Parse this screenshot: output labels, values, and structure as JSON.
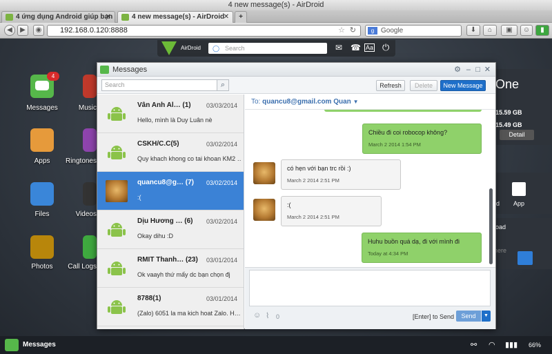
{
  "browser": {
    "window_title": "4 new message(s) - AirDroid",
    "tabs": [
      {
        "label": "4 ứng dụng Android giúp bạn d…"
      },
      {
        "label": "4 new message(s) - AirDroid"
      }
    ],
    "url": "192.168.0.120:8888",
    "search_placeholder": "Google"
  },
  "airdroid": {
    "logo": "AirDroid",
    "search_placeholder": "Search"
  },
  "desktop": {
    "apps": [
      {
        "label": "Messages",
        "badge": "4"
      },
      {
        "label": "Music"
      },
      {
        "label": "Apps"
      },
      {
        "label": "Ringtones"
      },
      {
        "label": "Files"
      },
      {
        "label": "Videos"
      },
      {
        "label": "Photos"
      },
      {
        "label": "Call Logs"
      }
    ],
    "right_panel": {
      "title": "One",
      "storage1": "15.59 GB",
      "storage2": "15.49 GB",
      "detail": "Detail",
      "card": "rd",
      "app": "App",
      "upload": "load",
      "here": "here"
    }
  },
  "messages_window": {
    "title": "Messages",
    "search_placeholder": "Search",
    "toolbar": {
      "refresh": "Refresh",
      "delete": "Delete",
      "new": "New Message"
    },
    "threads": [
      {
        "name": "Vân Anh Al…",
        "count": "(1)",
        "date": "03/03/2014",
        "preview": "Hello, mình là Duy Luân nè"
      },
      {
        "name": "CSKH/C.C(5)",
        "count": "",
        "date": "03/02/2014",
        "preview": "Quy khach khong co tai khoan KM2 …"
      },
      {
        "name": "quancu8@g…",
        "count": "(7)",
        "date": "03/02/2014",
        "preview": ":(",
        "selected": true
      },
      {
        "name": "Dịu Hương …",
        "count": "(6)",
        "date": "03/02/2014",
        "preview": "Okay dihu :D"
      },
      {
        "name": "RMIT Thanh…",
        "count": "(23)",
        "date": "03/01/2014",
        "preview": "Ok vaayh thứ mấy dc bạn chọn đj"
      },
      {
        "name": "8788(1)",
        "count": "",
        "date": "03/01/2014",
        "preview": "(Zalo) 6051 la ma kich hoat Zalo. H…"
      }
    ],
    "conversation": {
      "to_label": "To:",
      "to_value": "quancu8@gmail.com Quan",
      "messages": [
        {
          "text": "Chiều đi coi robocop không?",
          "time": "March 2 2014 1:54 PM",
          "side": "out"
        },
        {
          "text": "có hẹn với bạn trc rồi :)",
          "time": "March 2 2014 2:51 PM",
          "side": "in"
        },
        {
          "text": ":(",
          "time": "March 2 2014 2:51 PM",
          "side": "in"
        },
        {
          "text": "Huhu buồn quá dạ, đi với mình đi",
          "time": "Today at 4:34 PM",
          "side": "out"
        }
      ],
      "attach_count": "0",
      "enter_hint": "[Enter] to Send",
      "send": "Send"
    }
  },
  "taskbar": {
    "label": "Messages",
    "battery": "66%"
  }
}
